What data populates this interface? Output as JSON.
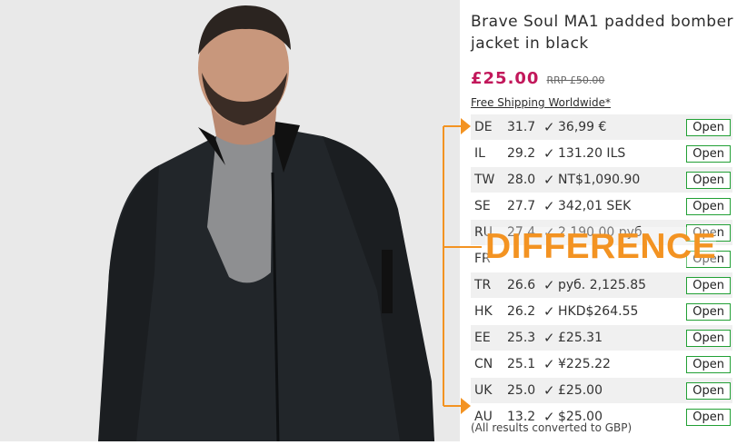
{
  "product": {
    "title": "Brave Soul MA1 padded bomber jacket in black",
    "price": "£25.00",
    "rrp": "RRP £50.00",
    "shipping": "Free Shipping Worldwide*"
  },
  "comparison": {
    "rows": [
      {
        "code": "DE",
        "score": "31.7",
        "check": "✓",
        "price": "36,99 €",
        "button": "Open"
      },
      {
        "code": "IL",
        "score": "29.2",
        "check": "✓",
        "price": "131.20 ILS",
        "button": "Open"
      },
      {
        "code": "TW",
        "score": "28.0",
        "check": "✓",
        "price": "NT$1,090.90",
        "button": "Open"
      },
      {
        "code": "SE",
        "score": "27.7",
        "check": "✓",
        "price": "342,01 SEK",
        "button": "Open"
      },
      {
        "code": "RU",
        "score": "27.4",
        "check": "✓",
        "price": "2 190,00 руб.",
        "button": "Open"
      },
      {
        "code": "FR",
        "score": "",
        "check": "",
        "price": "",
        "button": "Open"
      },
      {
        "code": "TR",
        "score": "26.6",
        "check": "✓",
        "price": "руб. 2,125.85",
        "button": "Open"
      },
      {
        "code": "HK",
        "score": "26.2",
        "check": "✓",
        "price": "HKD$264.55",
        "button": "Open"
      },
      {
        "code": "EE",
        "score": "25.3",
        "check": "✓",
        "price": "£25.31",
        "button": "Open"
      },
      {
        "code": "CN",
        "score": "25.1",
        "check": "✓",
        "price": "¥225.22",
        "button": "Open"
      },
      {
        "code": "UK",
        "score": "25.0",
        "check": "✓",
        "price": "£25.00",
        "button": "Open"
      },
      {
        "code": "AU",
        "score": "13.2",
        "check": "✓",
        "price": "$25.00",
        "button": "Open"
      }
    ],
    "footnote": "(All results converted to GBP)"
  },
  "overlay": {
    "label": "DIFFERENCE",
    "color": "#f39322"
  },
  "colors": {
    "price": "#c2185b",
    "button_border": "#22a035",
    "photo_bg": "#e9e9e9",
    "jacket": "#22262a"
  }
}
